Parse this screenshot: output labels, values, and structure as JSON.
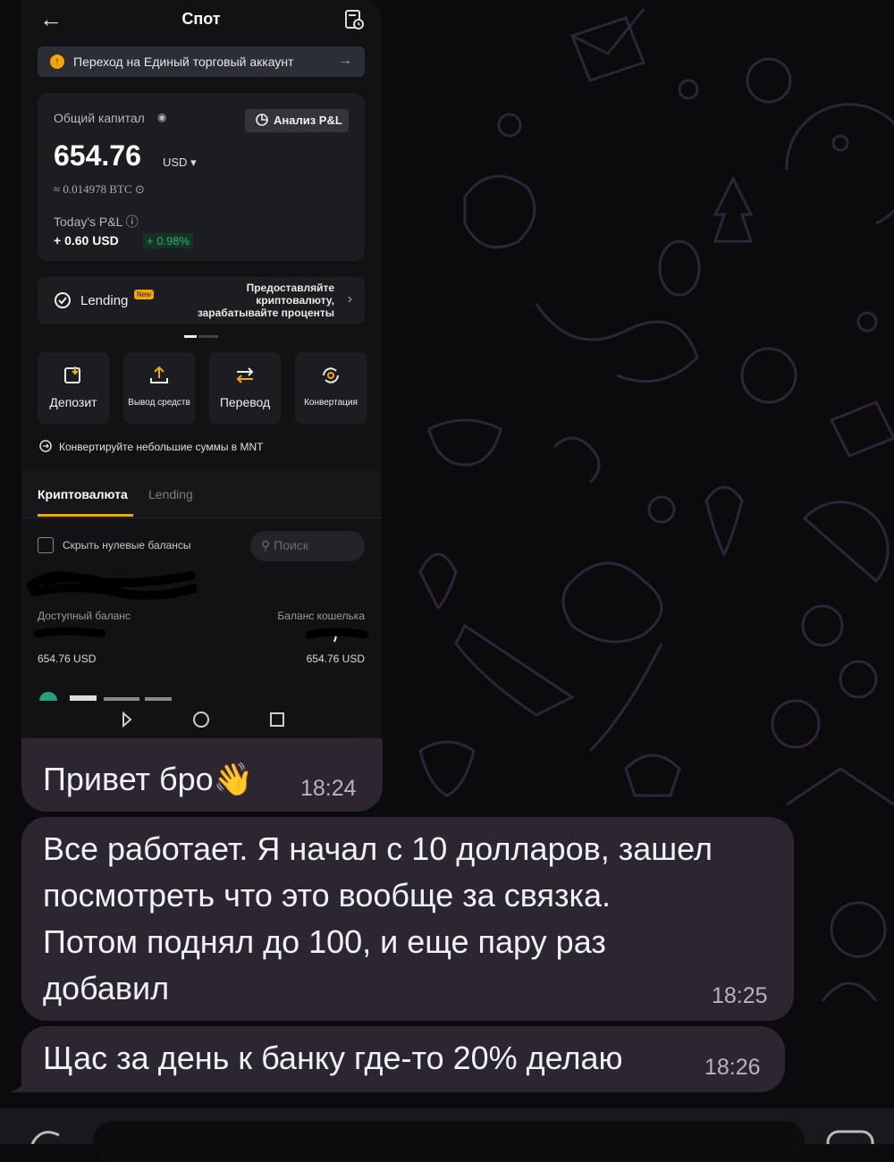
{
  "screenshot": {
    "title": "Спот",
    "banner_text": "Переход на Единый торговый аккаунт",
    "capital_label": "Общий капитал",
    "pnl_button": "Анализ P&L",
    "amount": "654.76",
    "currency": "USD",
    "btc_equiv": "≈ 0.014978 BTC",
    "today_pnl_label": "Today's P&L",
    "today_pnl_value": "+ 0.60 USD",
    "today_pnl_pct": "+ 0.98%",
    "lending": {
      "name": "Lending",
      "badge": "New",
      "desc_line1": "Предоставляйте",
      "desc_line2": "криптовалюту,",
      "desc_line3": "зарабатывайте проценты"
    },
    "actions": [
      "Депозит",
      "Вывод средств",
      "Перевод",
      "Конвертация"
    ],
    "convert_note": "Конвертируйте небольшие суммы в MNT",
    "tabs": [
      "Криптовалюта",
      "Lending"
    ],
    "hide_zero": "Скрыть нулевые балансы",
    "search_placeholder": "Поиск",
    "available_label": "Доступный баланс",
    "wallet_label": "Баланс кошелька",
    "available_value": "654.76 USD",
    "wallet_value": "654.76 USD"
  },
  "messages": [
    {
      "text": "Привет бро👋",
      "time": "18:24"
    },
    {
      "lines": [
        "Все работает. Я начал с 10 долларов, зашел",
        "посмотреть что это вообще за связка.",
        "Потом поднял до 100, и еще пару раз",
        "добавил"
      ],
      "time": "18:25"
    },
    {
      "text": "Щас за день к банку где-то 20% делаю",
      "time": "18:26"
    }
  ],
  "colors": {
    "accent": "#f7a600",
    "bubble": "#2b2630",
    "positive": "#20b26c"
  }
}
